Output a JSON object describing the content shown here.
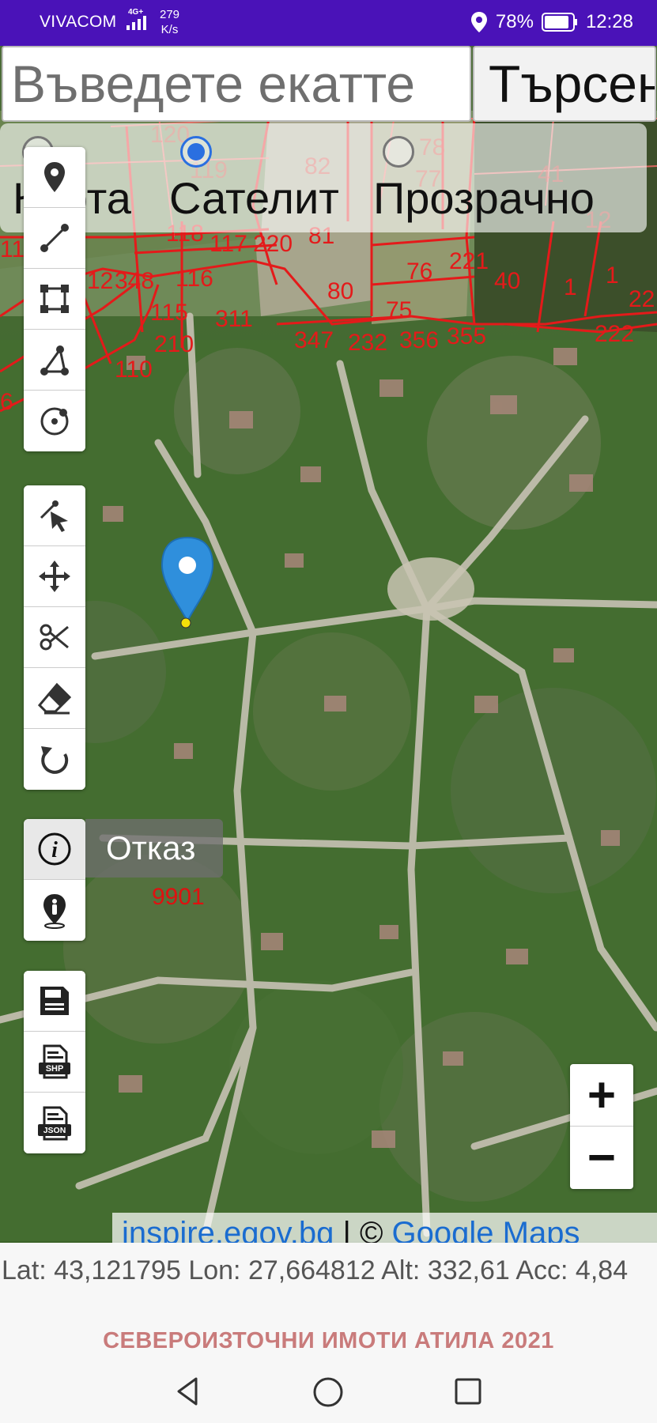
{
  "status_bar": {
    "carrier": "VIVACOM",
    "network": "4G+",
    "speed_value": "279",
    "speed_unit": "K/s",
    "battery": "78%",
    "time": "12:28"
  },
  "search": {
    "placeholder": "Въведете екатте",
    "button_label": "Търсене"
  },
  "layer_options": [
    {
      "label": "Карта",
      "checked": false
    },
    {
      "label": "Сателит",
      "checked": true
    },
    {
      "label": "Прозрачно",
      "checked": false
    }
  ],
  "toolbar_groups": [
    {
      "tools": [
        "marker-icon",
        "line-icon",
        "polygon-icon",
        "angle-icon",
        "circle-icon"
      ]
    },
    {
      "tools": [
        "select-icon",
        "move-icon",
        "cut-icon",
        "eraser-icon",
        "undo-icon"
      ]
    },
    {
      "tools": [
        "info-icon",
        "gps-person-icon"
      ]
    },
    {
      "tools": [
        "save-icon",
        "shp-icon",
        "json-icon"
      ]
    }
  ],
  "cancel_label": "Отказ",
  "parcel_id": "9901",
  "map_labels": [
    "120",
    "119",
    "118",
    "117",
    "220",
    "81",
    "82",
    "78",
    "77",
    "76",
    "221",
    "40",
    "1",
    "1",
    "22",
    "80",
    "75",
    "116",
    "115",
    "311",
    "210",
    "110",
    "347",
    "232",
    "356",
    "355",
    "222",
    "12",
    "348",
    "11",
    "6",
    "41",
    "12"
  ],
  "zoom": {
    "in": "+",
    "out": "−"
  },
  "attribution": {
    "source": "inspire.egov.bg",
    "separator": " | © ",
    "maps": "Google Maps"
  },
  "location": {
    "text": "Lat: 43,121795 Lon: 27,664812 Alt: 332,61 Acc: 4,84"
  },
  "footer_title": "СЕВЕРОИЗТОЧНИ ИМОТИ АТИЛА 2021",
  "colors": {
    "status_bar": "#4a12b8",
    "parcel_lines": "#e41a1a",
    "radio_selected": "#2a6fe0",
    "pin": "#2f8fdc",
    "footer_title": "#c97b7b"
  }
}
